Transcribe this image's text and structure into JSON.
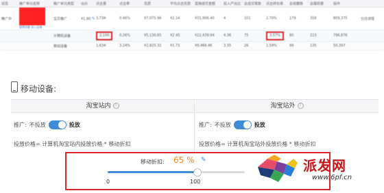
{
  "table": {
    "headers": [
      "状态",
      "推广单元名称",
      "推广单元类型",
      "出价",
      "点击量",
      "点击率",
      "花费",
      "平均点击花费",
      "直接成交金额",
      "投入产出比",
      "总成交笔数",
      "点击转化率",
      "总收藏数",
      "总展现量",
      "操作"
    ],
    "row_main": {
      "status": "推广中",
      "actions": "管理创意 进入店铺",
      "type": "宝贝推广",
      "bid": "¥1.80",
      "clicks": "3,734",
      "ctr": "0.46%",
      "cost": "¥7,075.96",
      "avg_cpc": "¥2.14",
      "revenue": "¥31,906.40",
      "roi": "4",
      "orders": "101",
      "conv_rate": "2.70%",
      "favorites": "179",
      "carts": "358",
      "impressions": "809,375",
      "op": "分日详情"
    },
    "row_pc": {
      "label": "计算机设备",
      "clicks": "2,100",
      "ctr": "0.26%",
      "cost": "¥5,130.65",
      "avg_cpc": "¥2.45",
      "revenue": "¥22,439.94",
      "roi": "4.36",
      "orders": "75",
      "conv_rate": "3.57%",
      "favorites": "80",
      "carts": "223",
      "impressions": "796,876"
    },
    "row_mobile": {
      "label": "移动设备",
      "clicks": "1,634",
      "ctr": "3.24%",
      "cost": "¥2,825.31",
      "avg_cpc": "¥1.73",
      "revenue": "¥9,466.46",
      "roi": "3.35",
      "orders": "26",
      "conv_rate": "1.59%",
      "favorites": "99",
      "carts": "135",
      "impressions": "50,397"
    }
  },
  "mobile": {
    "title": "移动设备:",
    "inside": {
      "title": "淘宝站内",
      "promote_label": "推广:",
      "off_label": "不投放",
      "on_label": "投放",
      "formula": "投放价格= 计算机淘宝站内投放价格 * 移动折扣"
    },
    "outside": {
      "title": "淘宝站外",
      "promote_label": "推广:",
      "off_label": "不投放",
      "on_label": "投放",
      "formula": "投放价格= 计算机淘宝站外投放价格 * 移动折扣"
    },
    "discount": {
      "label": "移动折扣:",
      "value": "65 %",
      "percent": 65,
      "min": "0",
      "max": "100"
    }
  },
  "watermark": {
    "text": "派发网",
    "url": "www.6pf.cn"
  },
  "colors": {
    "accent": "#3f8cd6",
    "highlight": "#d9262a",
    "discount_value": "#f08a24"
  }
}
